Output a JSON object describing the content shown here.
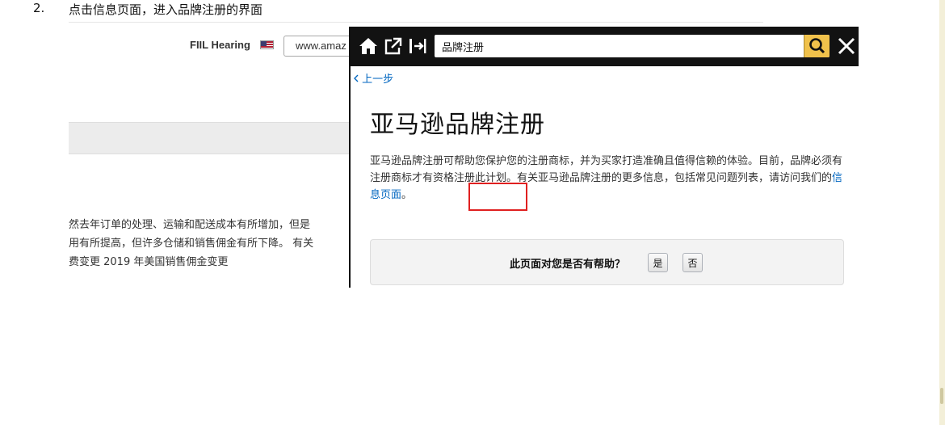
{
  "instruction": {
    "number": "2.",
    "text": "点击信息页面，进入品牌注册的界面"
  },
  "background_page": {
    "brand_label": "FIIL Hearing",
    "url_text": "www.amaz",
    "text_lines": [
      "然去年订单的处理、运输和配送成本有所增加，但是",
      "用有所提高，但许多仓储和销售佣金有所下降。 有关",
      "费变更 2019 年美国销售佣金变更"
    ]
  },
  "help_panel": {
    "search": {
      "value": "品牌注册"
    },
    "back_label": "上一步",
    "title": "亚马逊品牌注册",
    "body_before_link": "亚马逊品牌注册可帮助您保护您的注册商标，并为买家打造准确且值得信赖的体验。目前，品牌必须有注册商标才有资格注册此计划。有关亚马逊品牌注册的更多信息，包括常见问题列表，请访问我们的",
    "link_text": "信息页面",
    "body_after_link": "。",
    "feedback": {
      "question": "此页面对您是否有帮助？",
      "yes_label": "是",
      "no_label": "否"
    }
  },
  "icons": {
    "home": "home-icon",
    "popout": "external-link-icon",
    "dock": "dock-right-icon",
    "search": "search-icon",
    "close": "close-icon",
    "back": "chevron-left-icon"
  },
  "colors": {
    "panel_bar": "#121212",
    "search_button": "#f0c14b",
    "link": "#0066c0",
    "highlight_box": "#e02020"
  }
}
